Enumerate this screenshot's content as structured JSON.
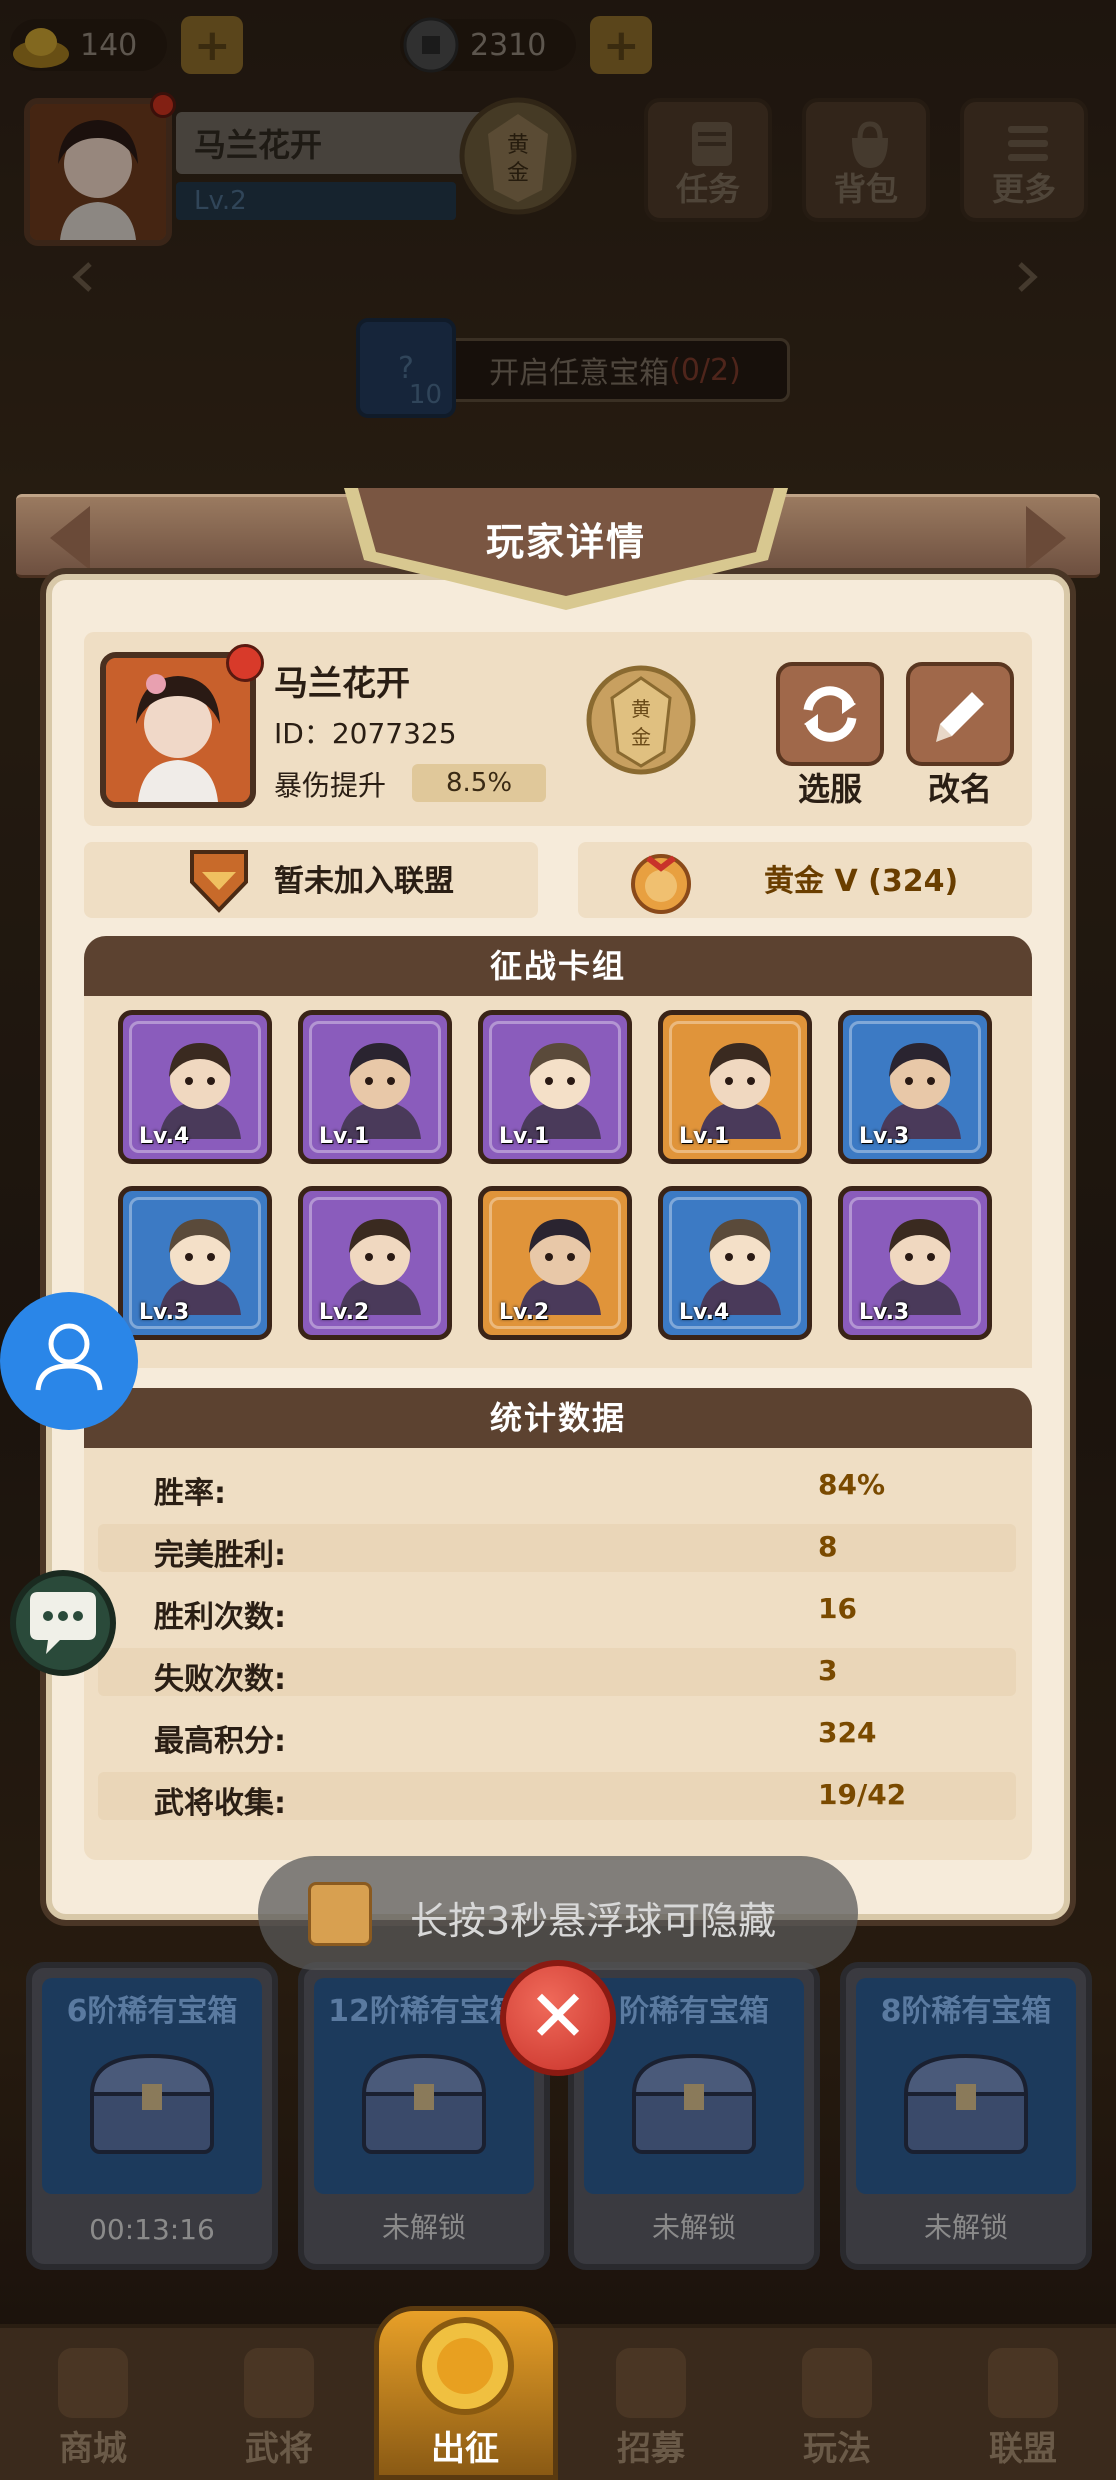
{
  "currency": {
    "gold": "140",
    "coins": "2310"
  },
  "header": {
    "player_name": "马兰花开",
    "level": "Lv.2",
    "rank_emblem": "黄金",
    "buttons": [
      {
        "label": "任务",
        "icon": "scroll-icon"
      },
      {
        "label": "背包",
        "icon": "bag-icon"
      },
      {
        "label": "更多",
        "icon": "menu-icon"
      }
    ]
  },
  "quest": {
    "count_badge": "10",
    "text": "开启任意宝箱",
    "progress": "(0/2)"
  },
  "panel": {
    "title": "玩家详情",
    "player": {
      "name": "马兰花开",
      "id": "ID：2077325",
      "crit_label": "暴伤提升",
      "crit_value": "8.5%",
      "emblem": "黄金"
    },
    "actions": [
      {
        "label": "选服",
        "icon": "refresh-icon"
      },
      {
        "label": "改名",
        "icon": "pencil-icon"
      }
    ],
    "guild_text": "暂未加入联盟",
    "rank_text": "黄金 V (324)",
    "deck": {
      "title": "征战卡组",
      "cards": [
        {
          "level": "Lv.4",
          "rarity": "purple"
        },
        {
          "level": "Lv.1",
          "rarity": "purple"
        },
        {
          "level": "Lv.1",
          "rarity": "purple"
        },
        {
          "level": "Lv.1",
          "rarity": "orange"
        },
        {
          "level": "Lv.3",
          "rarity": "blue"
        },
        {
          "level": "Lv.3",
          "rarity": "blue"
        },
        {
          "level": "Lv.2",
          "rarity": "purple"
        },
        {
          "level": "Lv.2",
          "rarity": "orange"
        },
        {
          "level": "Lv.4",
          "rarity": "blue"
        },
        {
          "level": "Lv.3",
          "rarity": "purple"
        }
      ]
    },
    "stats": {
      "title": "统计数据",
      "rows": [
        {
          "label": "胜率:",
          "value": "84%"
        },
        {
          "label": "完美胜利:",
          "value": "8"
        },
        {
          "label": "胜利次数:",
          "value": "16"
        },
        {
          "label": "失败次数:",
          "value": "3"
        },
        {
          "label": "最高积分:",
          "value": "324"
        },
        {
          "label": "武将收集:",
          "value": "19/42"
        }
      ]
    }
  },
  "toast": "长按3秒悬浮球可隐藏",
  "chests": [
    {
      "name": "6阶稀有宝箱",
      "status": "00:13:16"
    },
    {
      "name": "12阶稀有宝箱",
      "status": "未解锁"
    },
    {
      "name": "阶稀有宝箱",
      "status": "未解锁"
    },
    {
      "name": "8阶稀有宝箱",
      "status": "未解锁"
    }
  ],
  "bottom_nav": [
    {
      "label": "商城"
    },
    {
      "label": "武将"
    },
    {
      "label": "出征"
    },
    {
      "label": "招募"
    },
    {
      "label": "玩法"
    },
    {
      "label": "联盟"
    }
  ],
  "colors": {
    "panel_bg": "#f6ebda",
    "section_header": "#5c4230",
    "stat_value": "#7a4a00",
    "close_red": "#c8322a"
  }
}
